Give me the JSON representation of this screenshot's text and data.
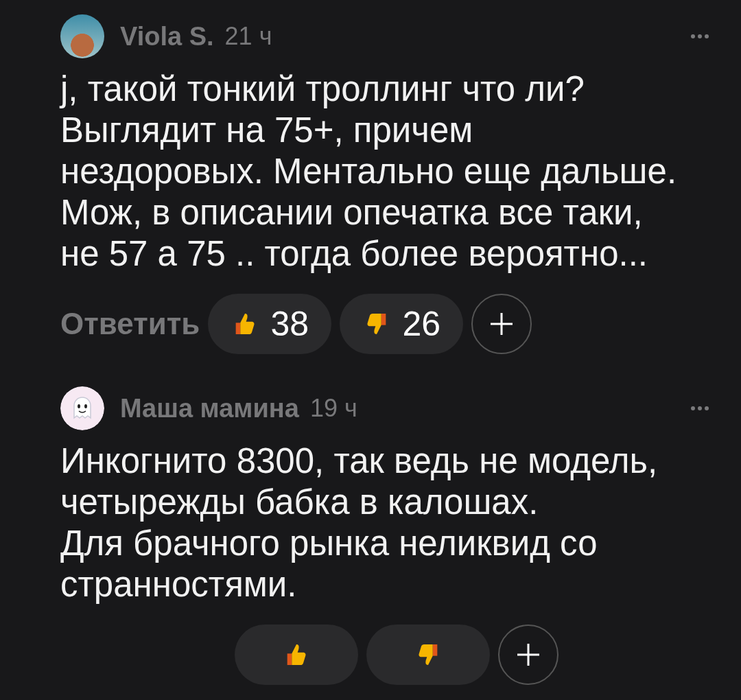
{
  "comments": [
    {
      "author": "Viola S.",
      "time": "21 ч",
      "avatar": {
        "kind": "photo"
      },
      "text": "j, такой тонкий троллинг что ли?\nВыглядит на 75+, причем\nнездоровых. Ментально еще дальше.\nМож, в описании опечатка все таки,\nне 57 а 75 .. тогда более вероятно...",
      "reply": "Ответить",
      "reactions": [
        {
          "kind": "like",
          "count": "38"
        },
        {
          "kind": "dislike",
          "count": "26"
        }
      ]
    },
    {
      "author": "Маша мамина",
      "time": "19 ч",
      "avatar": {
        "kind": "ghost"
      },
      "text": "Инкогнито 8300, так ведь не модель,\nчетырежды бабка в калошах.\nДля брачного рынка неликвид со\nстранностями.",
      "reactions": [
        {
          "kind": "like"
        },
        {
          "kind": "dislike"
        }
      ]
    }
  ]
}
